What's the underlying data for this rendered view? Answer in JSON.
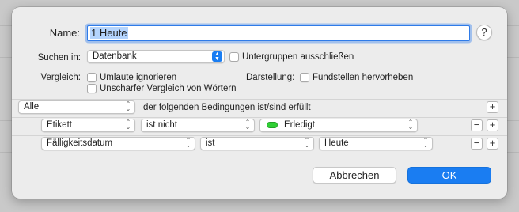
{
  "dialog": {
    "name_label": "Name:",
    "name_value": "1 Heute",
    "help_label": "?",
    "search_in_label": "Suchen in:",
    "search_in_value": "Datenbank",
    "exclude_subgroups_label": "Untergruppen ausschließen",
    "compare_label": "Vergleich:",
    "ignore_umlauts_label": "Umlaute ignorieren",
    "fuzzy_compare_label": "Unscharfer Vergleich von Wörtern",
    "display_label": "Darstellung:",
    "highlight_occurrences_label": "Fundstellen hervorheben"
  },
  "conditions": {
    "match_mode": "Alle",
    "match_text": "der folgenden Bedingungen ist/sind erfüllt",
    "add_label": "+",
    "remove_label": "−",
    "rows": [
      {
        "field": "Etikett",
        "operator": "ist nicht",
        "value": "Erledigt",
        "value_color": "#2fcf34"
      },
      {
        "field": "Fälligkeitsdatum",
        "operator": "ist",
        "value": "Heute"
      }
    ]
  },
  "buttons": {
    "cancel": "Abbrechen",
    "ok": "OK"
  },
  "colors": {
    "accent": "#1a7df2",
    "label_green": "#2fcf34"
  }
}
